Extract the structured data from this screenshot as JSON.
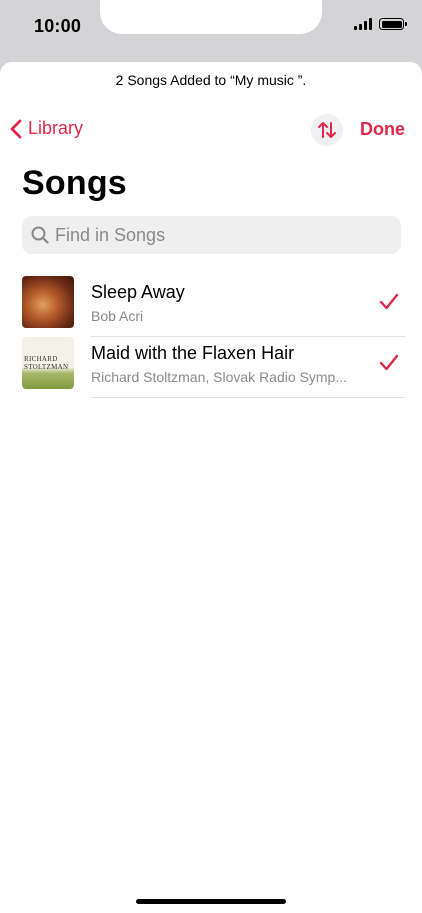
{
  "status_bar": {
    "time": "10:00"
  },
  "toast": {
    "message": "2 Songs Added to “My music ”."
  },
  "nav": {
    "back_label": "Library",
    "done_label": "Done"
  },
  "page": {
    "title": "Songs"
  },
  "search": {
    "placeholder": "Find in Songs"
  },
  "songs": [
    {
      "title": "Sleep Away",
      "artist": "Bob Acri",
      "checked": true
    },
    {
      "title": "Maid with the Flaxen Hair",
      "artist": "Richard Stoltzman, Slovak Radio Symp...",
      "checked": true,
      "artwork_text": "RICHARD STOLTZMAN"
    }
  ],
  "colors": {
    "accent": "#e0294a",
    "secondary_text": "#8a8a8e"
  }
}
